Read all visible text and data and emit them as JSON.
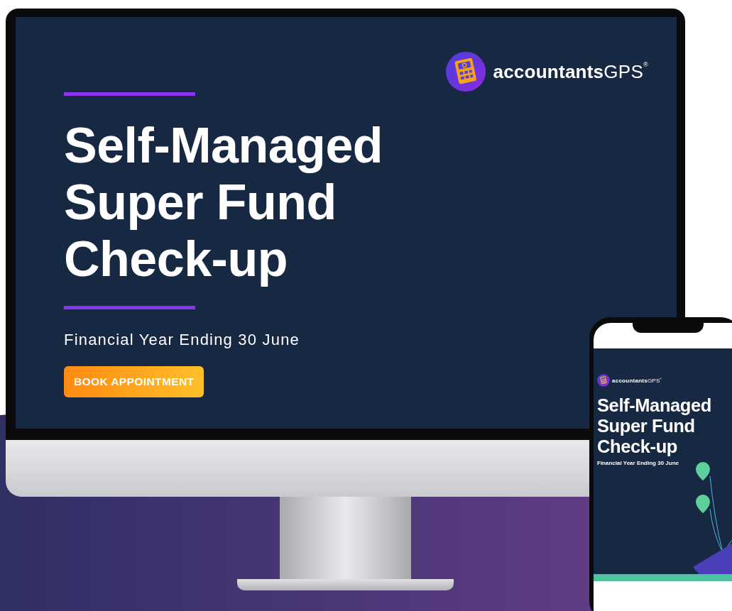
{
  "monitor": {
    "logo": "**accountants**GPS$^{®}$",
    "title_lines": [
      "Self-Managed",
      "Super Fund",
      "Check-up"
    ],
    "subtitle": "Financial Year Ending 30 June",
    "button": "BOOK APPOINTMENT"
  },
  "phone": {
    "logo": "**accountants**GPS$^{®}$",
    "title_lines": [
      "Self-Managed",
      "Super Fund",
      "Check-up"
    ],
    "subtitle": "Financial Year Ending 30 June"
  }
}
